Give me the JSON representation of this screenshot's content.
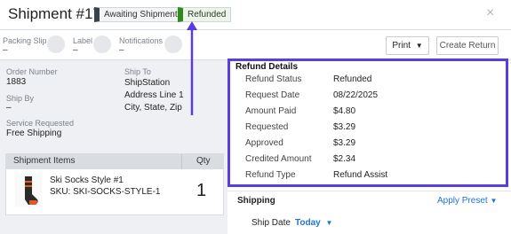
{
  "header": {
    "title": "Shipment #17",
    "badges": [
      "Awaiting Shipment",
      "Refunded"
    ],
    "close_icon": "×"
  },
  "subheader": {
    "packing_slip_label": "Packing Slip",
    "packing_slip_value": "–",
    "label_label": "Label",
    "label_value": "–",
    "notifications_label": "Notifications",
    "notifications_value": "–",
    "print_button": "Print",
    "create_return_button": "Create Return"
  },
  "order": {
    "order_number_label": "Order Number",
    "order_number": "1883",
    "ship_by_label": "Ship By",
    "ship_by_value": "–",
    "ship_to_label": "Ship To",
    "ship_to_lines": [
      "ShipStation",
      "Address Line 1",
      "City, State, Zip"
    ],
    "service_label": "Service Requested",
    "service_value": "Free Shipping"
  },
  "items": {
    "title": "Shipment Items",
    "qty_header": "Qty",
    "list": [
      {
        "name": "Ski Socks Style #1",
        "sku": "SKU: SKI-SOCKS-STYLE-1",
        "qty": "1"
      }
    ]
  },
  "refund": {
    "title": "Refund Details",
    "rows": [
      {
        "label": "Refund Status",
        "value": "Refunded"
      },
      {
        "label": "Request Date",
        "value": "08/22/2025"
      },
      {
        "label": "Amount Paid",
        "value": "$4.80"
      },
      {
        "label": "Requested",
        "value": "$3.29"
      },
      {
        "label": "Approved",
        "value": "$3.29"
      },
      {
        "label": "Credited Amount",
        "value": "$2.34"
      },
      {
        "label": "Refund Type",
        "value": "Refund Assist"
      }
    ]
  },
  "shipping": {
    "label": "Shipping",
    "apply_preset": "Apply Preset",
    "ship_date_label": "Ship Date",
    "ship_date_value": "Today"
  },
  "colors": {
    "highlight": "#5a3ce0",
    "link": "#1f74d6",
    "refunded_green": "#2e8b1e"
  },
  "icons": [
    "close-icon",
    "chevron-down-icon",
    "sock-image"
  ]
}
